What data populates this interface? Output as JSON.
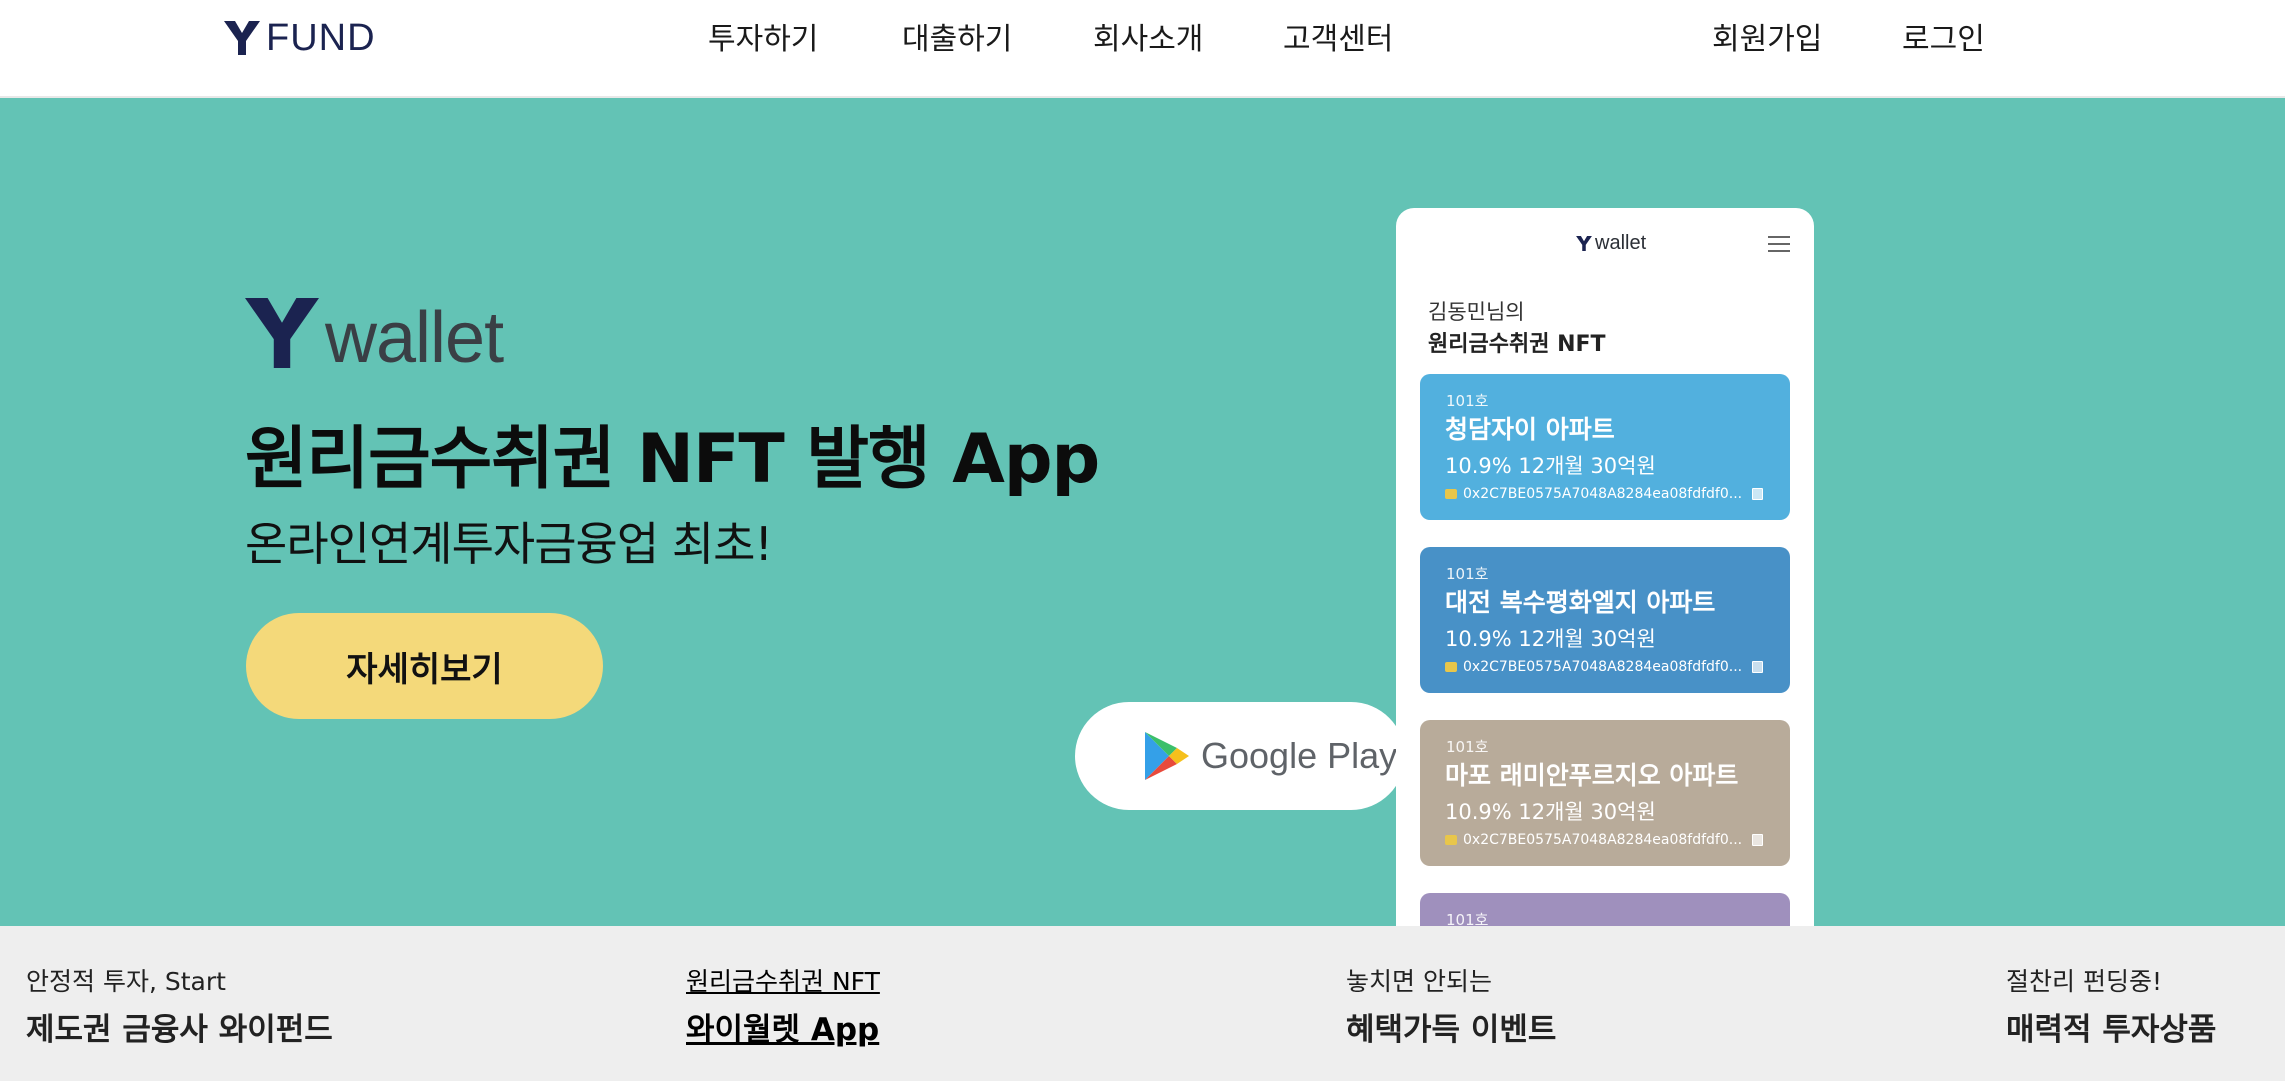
{
  "header": {
    "logo_text": "FUND",
    "nav": [
      "투자하기",
      "대출하기",
      "회사소개",
      "고객센터"
    ],
    "signup": "회원가입",
    "login": "로그인"
  },
  "hero": {
    "brand_text": "wallet",
    "title": "원리금수취권 NFT 발행 App",
    "subtitle": "온라인연계투자금융업 최초!",
    "cta": "자세히보기",
    "store_badge": "Google Play",
    "background_color": "#63c3b5",
    "cta_color": "#f4d97a"
  },
  "phone": {
    "logo_text": "wallet",
    "greeting": "김동민님의",
    "heading": "원리금수취권 NFT",
    "cards": [
      {
        "unit": "101호",
        "name": "청담자이 아파트",
        "terms": "10.9%  12개월  30억원",
        "address": "0x2C7BE0575A7048A8284ea08fdfdf0...",
        "color": "#52b0de"
      },
      {
        "unit": "101호",
        "name": "대전 복수평화엘지 아파트",
        "terms": "10.9%  12개월  30억원",
        "address": "0x2C7BE0575A7048A8284ea08fdfdf0...",
        "color": "#4891c7"
      },
      {
        "unit": "101호",
        "name": "마포 래미안푸르지오 아파트",
        "terms": "10.9%  12개월  30억원",
        "address": "0x2C7BE0575A7048A8284ea08fdfdf0...",
        "color": "#b8ab9a"
      },
      {
        "unit": "101호",
        "color": "#9f90bd"
      }
    ]
  },
  "bottom": [
    {
      "small": "안정적 투자, Start",
      "big": "제도권 금융사 와이펀드"
    },
    {
      "small": "원리금수취권 NFT",
      "big": "와이월렛 App"
    },
    {
      "small": "놓치면 안되는",
      "big": "혜택가득 이벤트"
    },
    {
      "small": "절찬리 펀딩중!",
      "big": "매력적 투자상품"
    }
  ]
}
